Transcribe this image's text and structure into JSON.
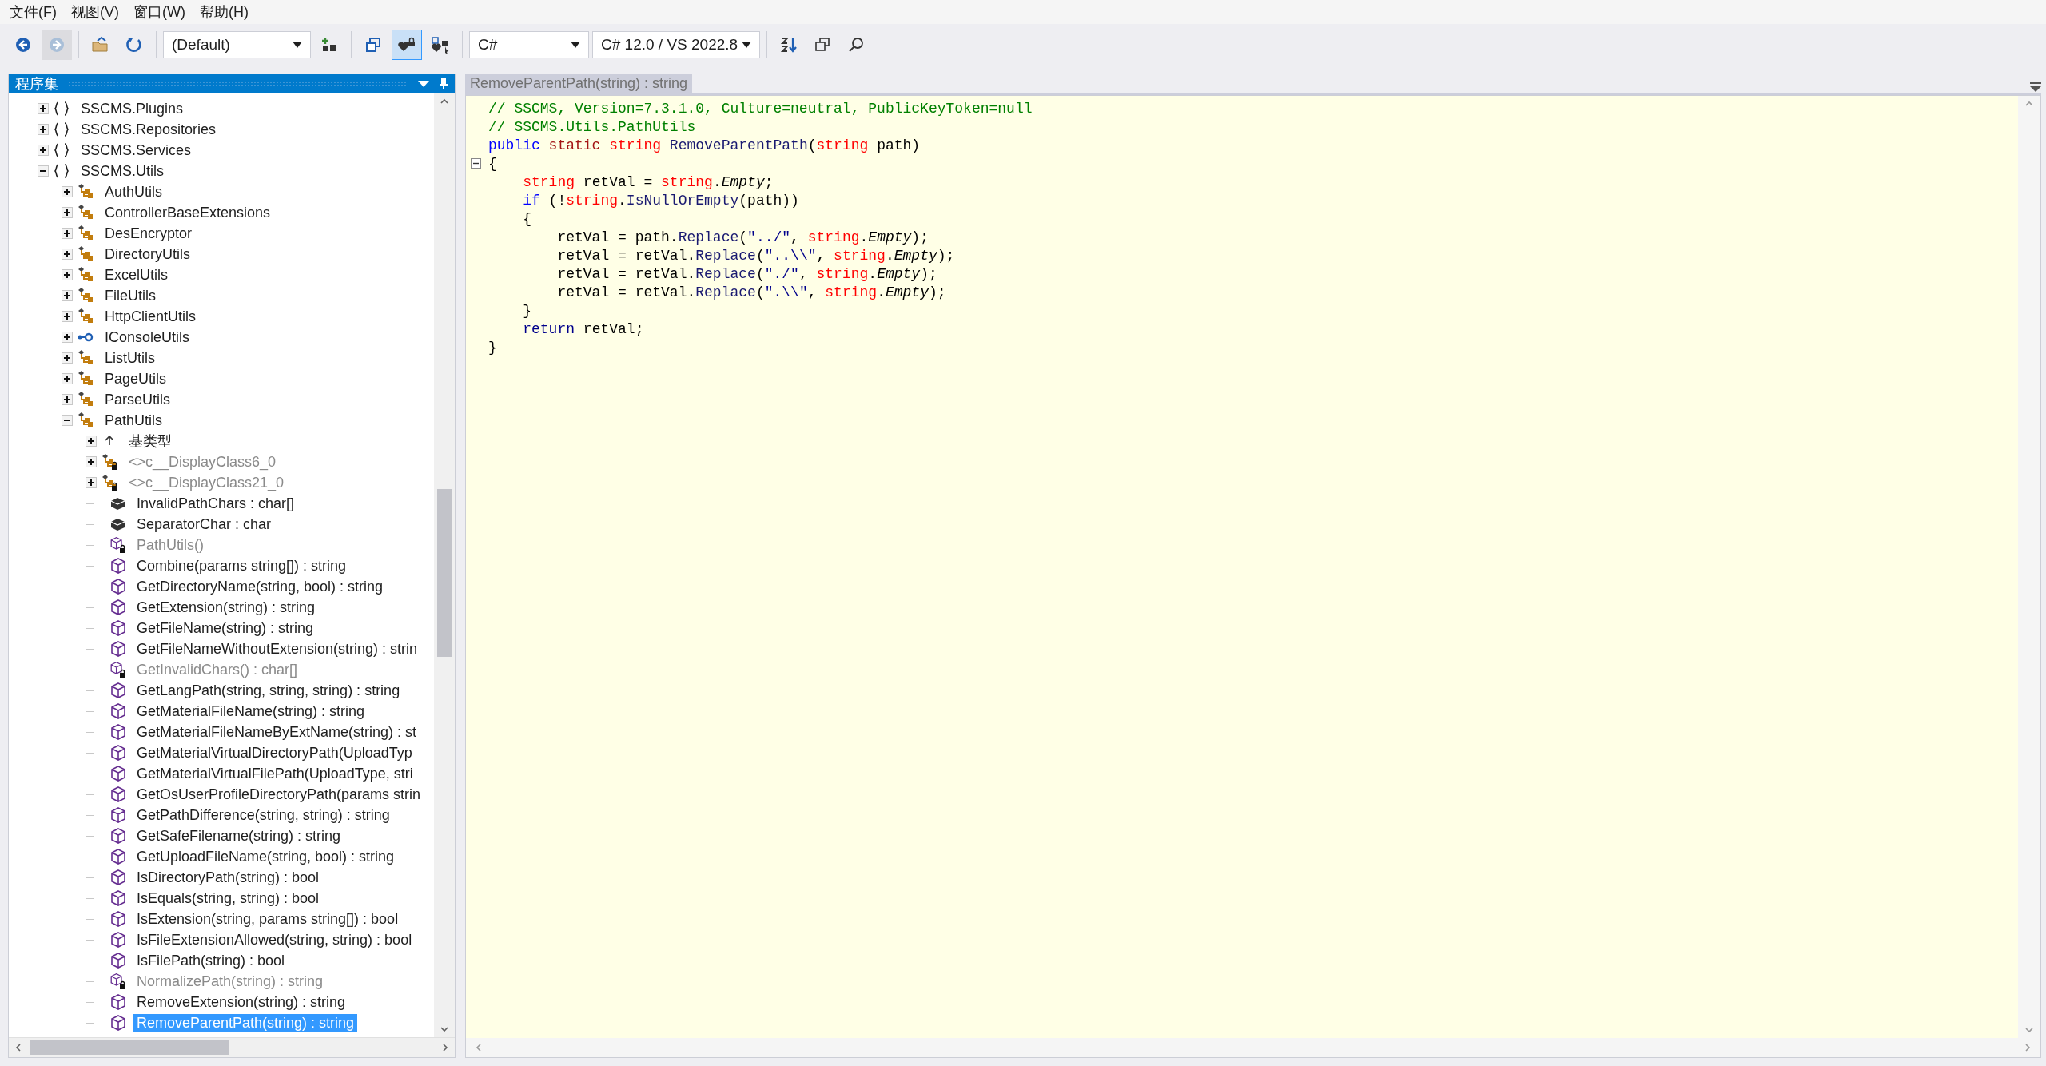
{
  "menu": [
    {
      "label": "文件(F)"
    },
    {
      "label": "视图(V)"
    },
    {
      "label": "窗口(W)"
    },
    {
      "label": "帮助(H)"
    }
  ],
  "toolbar": [
    {
      "kind": "back",
      "disabled": false,
      "pressed": false
    },
    {
      "kind": "forward",
      "disabled": true,
      "pressed": false
    },
    {
      "kind": "separator"
    },
    {
      "kind": "open",
      "disabled": false,
      "pressed": false
    },
    {
      "kind": "refresh",
      "disabled": false,
      "pressed": false
    },
    {
      "kind": "separator"
    },
    {
      "kind": "combo",
      "value": "(Default)"
    },
    {
      "kind": "add",
      "disabled": false,
      "pressed": false
    },
    {
      "kind": "separator"
    },
    {
      "kind": "windows",
      "disabled": false,
      "pressed": false
    },
    {
      "kind": "heartlock",
      "disabled": false,
      "pressed": true
    },
    {
      "kind": "heartstar",
      "disabled": false,
      "pressed": false
    },
    {
      "kind": "separator"
    },
    {
      "kind": "combo",
      "value": "C#"
    },
    {
      "kind": "combo",
      "value": "C# 12.0 / VS 2022.8"
    },
    {
      "kind": "separator"
    },
    {
      "kind": "sort",
      "disabled": false,
      "pressed": false
    },
    {
      "kind": "stack",
      "disabled": false,
      "pressed": false
    },
    {
      "kind": "search",
      "disabled": false,
      "pressed": false
    }
  ],
  "assembly_panel": {
    "title": "程序集",
    "tree": [
      {
        "label": "SSCMS.Plugins",
        "kind": "namespace",
        "expanded": false,
        "dimmed": false,
        "selected": false
      },
      {
        "label": "SSCMS.Repositories",
        "kind": "namespace",
        "expanded": false,
        "dimmed": false,
        "selected": false
      },
      {
        "label": "SSCMS.Services",
        "kind": "namespace",
        "expanded": false,
        "dimmed": false,
        "selected": false
      },
      {
        "label": "SSCMS.Utils",
        "kind": "namespace",
        "expanded": true,
        "dimmed": false,
        "selected": false,
        "children": [
          {
            "label": "AuthUtils",
            "kind": "class",
            "expanded": false,
            "dimmed": false,
            "selected": false
          },
          {
            "label": "ControllerBaseExtensions",
            "kind": "class",
            "expanded": false,
            "dimmed": false,
            "selected": false
          },
          {
            "label": "DesEncryptor",
            "kind": "class",
            "expanded": false,
            "dimmed": false,
            "selected": false
          },
          {
            "label": "DirectoryUtils",
            "kind": "class",
            "expanded": false,
            "dimmed": false,
            "selected": false
          },
          {
            "label": "ExcelUtils",
            "kind": "class",
            "expanded": false,
            "dimmed": false,
            "selected": false
          },
          {
            "label": "FileUtils",
            "kind": "class",
            "expanded": false,
            "dimmed": false,
            "selected": false
          },
          {
            "label": "HttpClientUtils",
            "kind": "class",
            "expanded": false,
            "dimmed": false,
            "selected": false
          },
          {
            "label": "IConsoleUtils",
            "kind": "interface",
            "expanded": false,
            "dimmed": false,
            "selected": false
          },
          {
            "label": "ListUtils",
            "kind": "class",
            "expanded": false,
            "dimmed": false,
            "selected": false
          },
          {
            "label": "PageUtils",
            "kind": "class",
            "expanded": false,
            "dimmed": false,
            "selected": false
          },
          {
            "label": "ParseUtils",
            "kind": "class",
            "expanded": false,
            "dimmed": false,
            "selected": false
          },
          {
            "label": "PathUtils",
            "kind": "class",
            "expanded": true,
            "dimmed": false,
            "selected": false,
            "children": [
              {
                "label": "基类型",
                "kind": "basetypes",
                "expanded": false,
                "dimmed": false,
                "selected": false
              },
              {
                "label": "<>c__DisplayClass6_0",
                "kind": "privateclass",
                "expanded": false,
                "dimmed": true,
                "selected": false
              },
              {
                "label": "<>c__DisplayClass21_0",
                "kind": "privateclass",
                "expanded": false,
                "dimmed": true,
                "selected": false
              },
              {
                "label": "InvalidPathChars : char[]",
                "kind": "field",
                "dimmed": false,
                "selected": false
              },
              {
                "label": "SeparatorChar : char",
                "kind": "field",
                "dimmed": false,
                "selected": false
              },
              {
                "label": "PathUtils()",
                "kind": "privatemethod",
                "dimmed": true,
                "selected": false
              },
              {
                "label": "Combine(params string[]) : string",
                "kind": "method",
                "dimmed": false,
                "selected": false
              },
              {
                "label": "GetDirectoryName(string, bool) : string",
                "kind": "method",
                "dimmed": false,
                "selected": false
              },
              {
                "label": "GetExtension(string) : string",
                "kind": "method",
                "dimmed": false,
                "selected": false
              },
              {
                "label": "GetFileName(string) : string",
                "kind": "method",
                "dimmed": false,
                "selected": false
              },
              {
                "label": "GetFileNameWithoutExtension(string) : strin",
                "kind": "method",
                "dimmed": false,
                "selected": false
              },
              {
                "label": "GetInvalidChars() : char[]",
                "kind": "privatemethod",
                "dimmed": true,
                "selected": false
              },
              {
                "label": "GetLangPath(string, string, string) : string",
                "kind": "method",
                "dimmed": false,
                "selected": false
              },
              {
                "label": "GetMaterialFileName(string) : string",
                "kind": "method",
                "dimmed": false,
                "selected": false
              },
              {
                "label": "GetMaterialFileNameByExtName(string) : st",
                "kind": "method",
                "dimmed": false,
                "selected": false
              },
              {
                "label": "GetMaterialVirtualDirectoryPath(UploadTyp",
                "kind": "method",
                "dimmed": false,
                "selected": false
              },
              {
                "label": "GetMaterialVirtualFilePath(UploadType, stri",
                "kind": "method",
                "dimmed": false,
                "selected": false
              },
              {
                "label": "GetOsUserProfileDirectoryPath(params strin",
                "kind": "method",
                "dimmed": false,
                "selected": false
              },
              {
                "label": "GetPathDifference(string, string) : string",
                "kind": "method",
                "dimmed": false,
                "selected": false
              },
              {
                "label": "GetSafeFilename(string) : string",
                "kind": "method",
                "dimmed": false,
                "selected": false
              },
              {
                "label": "GetUploadFileName(string, bool) : string",
                "kind": "method",
                "dimmed": false,
                "selected": false
              },
              {
                "label": "IsDirectoryPath(string) : bool",
                "kind": "method",
                "dimmed": false,
                "selected": false
              },
              {
                "label": "IsEquals(string, string) : bool",
                "kind": "method",
                "dimmed": false,
                "selected": false
              },
              {
                "label": "IsExtension(string, params string[]) : bool",
                "kind": "method",
                "dimmed": false,
                "selected": false
              },
              {
                "label": "IsFileExtensionAllowed(string, string) : bool",
                "kind": "method",
                "dimmed": false,
                "selected": false
              },
              {
                "label": "IsFilePath(string) : bool",
                "kind": "method",
                "dimmed": false,
                "selected": false
              },
              {
                "label": "NormalizePath(string) : string",
                "kind": "privatemethod",
                "dimmed": true,
                "selected": false
              },
              {
                "label": "RemoveExtension(string) : string",
                "kind": "method",
                "dimmed": false,
                "selected": false
              },
              {
                "label": "RemoveParentPath(string) : string",
                "kind": "method",
                "dimmed": false,
                "selected": true
              }
            ]
          }
        ]
      }
    ]
  },
  "editor": {
    "tab": "RemoveParentPath(string) : string",
    "lines": [
      {
        "kind": "plain",
        "tokens": [
          {
            "kind": "comment",
            "text": "// SSCMS, Version=7.3.1.0, Culture=neutral, PublicKeyToken=null"
          }
        ]
      },
      {
        "kind": "plain",
        "tokens": [
          {
            "kind": "comment",
            "text": "// SSCMS.Utils.PathUtils"
          }
        ]
      },
      {
        "kind": "plain",
        "tokens": [
          {
            "kind": "keyword",
            "text": "public"
          },
          {
            "kind": "modifier",
            "text": " static"
          },
          {
            "kind": "type",
            "text": " string"
          },
          {
            "kind": "method",
            "text": " RemoveParentPath"
          },
          {
            "kind": "plain",
            "text": "("
          },
          {
            "kind": "type",
            "text": "string"
          },
          {
            "kind": "plain",
            "text": " path)"
          }
        ]
      },
      {
        "kind": "foldstart",
        "tokens": [
          {
            "kind": "plain",
            "text": "{"
          }
        ]
      },
      {
        "kind": "foldline",
        "tokens": [
          {
            "kind": "type",
            "text": "    string"
          },
          {
            "kind": "plain",
            "text": " retVal = "
          },
          {
            "kind": "type",
            "text": "string"
          },
          {
            "kind": "plain",
            "text": "."
          },
          {
            "kind": "property",
            "text": "Empty"
          },
          {
            "kind": "plain",
            "text": ";"
          }
        ]
      },
      {
        "kind": "foldline",
        "tokens": [
          {
            "kind": "keyword",
            "text": "    if"
          },
          {
            "kind": "plain",
            "text": " (!"
          },
          {
            "kind": "type",
            "text": "string"
          },
          {
            "kind": "plain",
            "text": "."
          },
          {
            "kind": "method",
            "text": "IsNullOrEmpty"
          },
          {
            "kind": "plain",
            "text": "(path))"
          }
        ]
      },
      {
        "kind": "foldline",
        "tokens": [
          {
            "kind": "plain",
            "text": "    {"
          }
        ]
      },
      {
        "kind": "foldline",
        "tokens": [
          {
            "kind": "plain",
            "text": "        retVal = path."
          },
          {
            "kind": "method",
            "text": "Replace"
          },
          {
            "kind": "plain",
            "text": "("
          },
          {
            "kind": "string",
            "text": "\"../\""
          },
          {
            "kind": "plain",
            "text": ", "
          },
          {
            "kind": "type",
            "text": "string"
          },
          {
            "kind": "plain",
            "text": "."
          },
          {
            "kind": "property",
            "text": "Empty"
          },
          {
            "kind": "plain",
            "text": ");"
          }
        ]
      },
      {
        "kind": "foldline",
        "tokens": [
          {
            "kind": "plain",
            "text": "        retVal = retVal."
          },
          {
            "kind": "method",
            "text": "Replace"
          },
          {
            "kind": "plain",
            "text": "("
          },
          {
            "kind": "string",
            "text": "\"..\\\\\""
          },
          {
            "kind": "plain",
            "text": ", "
          },
          {
            "kind": "type",
            "text": "string"
          },
          {
            "kind": "plain",
            "text": "."
          },
          {
            "kind": "property",
            "text": "Empty"
          },
          {
            "kind": "plain",
            "text": ");"
          }
        ]
      },
      {
        "kind": "foldline",
        "tokens": [
          {
            "kind": "plain",
            "text": "        retVal = retVal."
          },
          {
            "kind": "method",
            "text": "Replace"
          },
          {
            "kind": "plain",
            "text": "("
          },
          {
            "kind": "string",
            "text": "\"./\""
          },
          {
            "kind": "plain",
            "text": ", "
          },
          {
            "kind": "type",
            "text": "string"
          },
          {
            "kind": "plain",
            "text": "."
          },
          {
            "kind": "property",
            "text": "Empty"
          },
          {
            "kind": "plain",
            "text": ");"
          }
        ]
      },
      {
        "kind": "foldline",
        "tokens": [
          {
            "kind": "plain",
            "text": "        retVal = retVal."
          },
          {
            "kind": "method",
            "text": "Replace"
          },
          {
            "kind": "plain",
            "text": "("
          },
          {
            "kind": "string",
            "text": "\".\\\\\""
          },
          {
            "kind": "plain",
            "text": ", "
          },
          {
            "kind": "type",
            "text": "string"
          },
          {
            "kind": "plain",
            "text": "."
          },
          {
            "kind": "property",
            "text": "Empty"
          },
          {
            "kind": "plain",
            "text": ");"
          }
        ]
      },
      {
        "kind": "foldline",
        "tokens": [
          {
            "kind": "plain",
            "text": "    }"
          }
        ]
      },
      {
        "kind": "foldline",
        "tokens": [
          {
            "kind": "keyword2",
            "text": "    return"
          },
          {
            "kind": "plain",
            "text": " retVal;"
          }
        ]
      },
      {
        "kind": "foldend",
        "tokens": [
          {
            "kind": "plain",
            "text": "}"
          }
        ]
      }
    ]
  }
}
